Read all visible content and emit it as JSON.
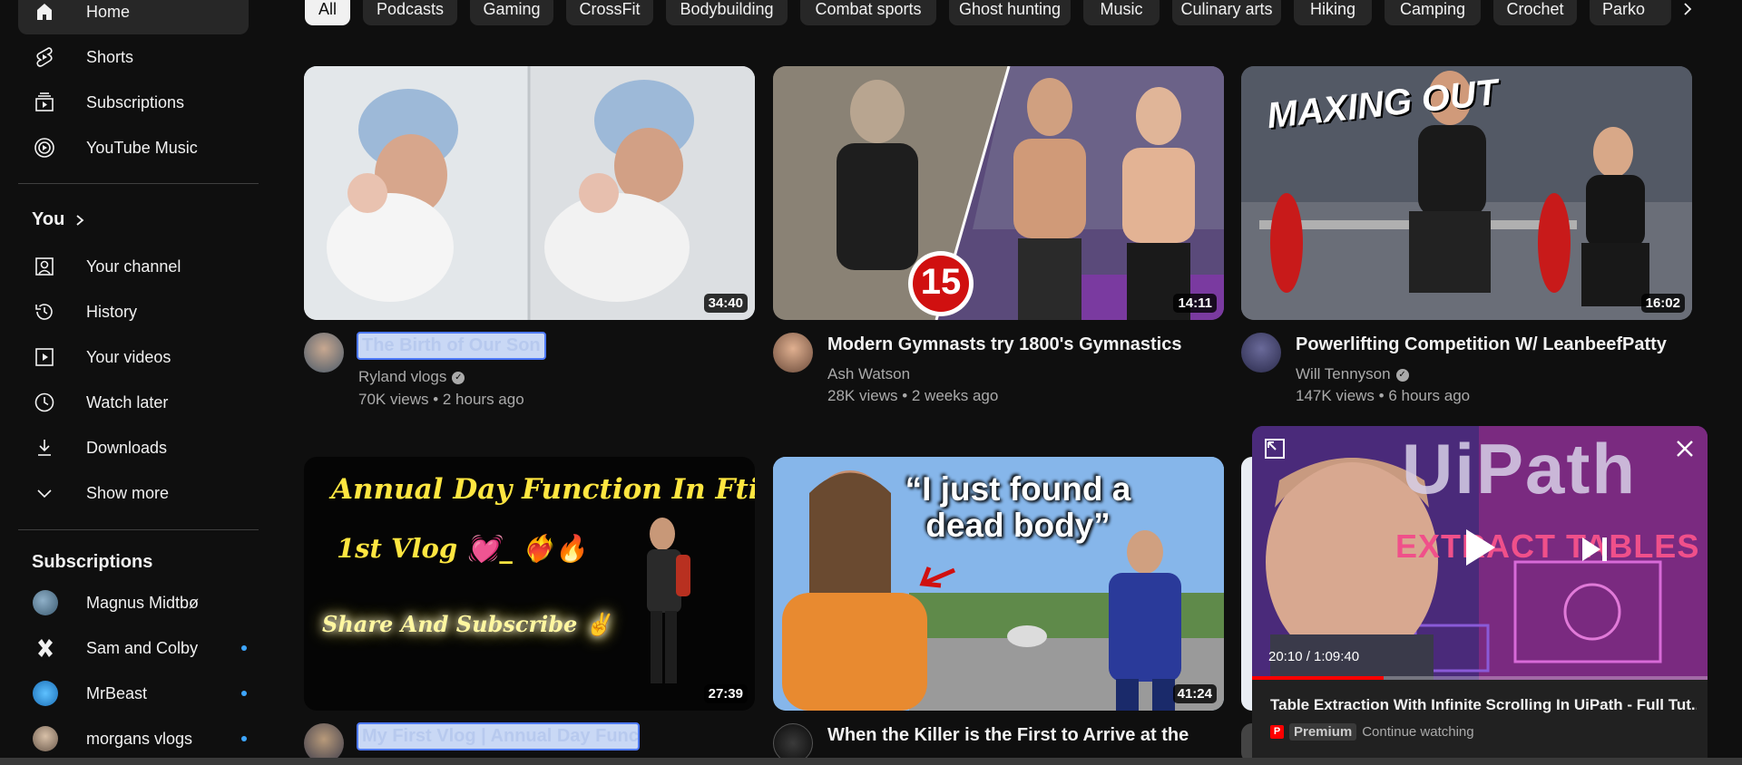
{
  "sidebar": {
    "main": [
      {
        "label": "Home",
        "icon": "home-icon",
        "active": true
      },
      {
        "label": "Shorts",
        "icon": "shorts-icon"
      },
      {
        "label": "Subscriptions",
        "icon": "subscriptions-icon"
      },
      {
        "label": "YouTube Music",
        "icon": "youtube-music-icon"
      }
    ],
    "you_heading": "You",
    "you": [
      {
        "label": "Your channel",
        "icon": "your-channel-icon"
      },
      {
        "label": "History",
        "icon": "history-icon"
      },
      {
        "label": "Your videos",
        "icon": "your-videos-icon"
      },
      {
        "label": "Watch later",
        "icon": "watch-later-icon"
      },
      {
        "label": "Downloads",
        "icon": "downloads-icon"
      },
      {
        "label": "Show more",
        "icon": "chevron-down-icon"
      }
    ],
    "subscriptions_heading": "Subscriptions",
    "subscriptions": [
      {
        "label": "Magnus Midtbø",
        "new": false
      },
      {
        "label": "Sam and Colby",
        "new": true
      },
      {
        "label": "MrBeast",
        "new": true
      },
      {
        "label": "morgans vlogs",
        "new": true
      }
    ]
  },
  "chips": [
    "All",
    "Podcasts",
    "Gaming",
    "CrossFit",
    "Bodybuilding",
    "Combat sports",
    "Ghost hunting",
    "Music",
    "Culinary arts",
    "Hiking",
    "Camping",
    "Crochet",
    "Parko"
  ],
  "videos": [
    {
      "title": "The Birth of Our Son",
      "channel": "Ryland vlogs",
      "verified": true,
      "meta": "70K views • 2 hours ago",
      "duration": "34:40",
      "selected": true
    },
    {
      "title": "Modern Gymnasts try 1800's Gymnastics",
      "channel": "Ash Watson",
      "verified": false,
      "meta": "28K views • 2 weeks ago",
      "duration": "14:11",
      "badge": "15"
    },
    {
      "title": "Powerlifting Competition W/ LeanbeefPatty",
      "channel": "Will Tennyson",
      "verified": true,
      "meta": "147K views • 6 hours ago",
      "duration": "16:02",
      "overlay": "MAXING OUT"
    },
    {
      "title": "My First Vlog | Annual Day Function |",
      "duration": "27:39",
      "selected": true,
      "overlay_lines": [
        "Annual Day Function In Fti.......!!",
        "1st Vlog 💓_ ❤️‍🔥🔥",
        "Share And Subscribe ✌️"
      ]
    },
    {
      "title": "When the Killer is the First to Arrive at the",
      "duration": "41:24",
      "overlay": "“I just found a dead body”"
    }
  ],
  "miniplayer": {
    "time": "20:10 / 1:09:40",
    "progress": 0.289,
    "title": "Table Extraction With Infinite Scrolling In UiPath - Full Tut...",
    "premium_label": "Premium",
    "continue_label": "Continue watching",
    "brand_text": "UiPath",
    "overlay_text": "EXTRACT TABLES"
  },
  "colors": {
    "background": "#0f0f0f",
    "chip": "#272727",
    "accent_red": "#ff0000",
    "link_blue": "#3ea6ff"
  }
}
